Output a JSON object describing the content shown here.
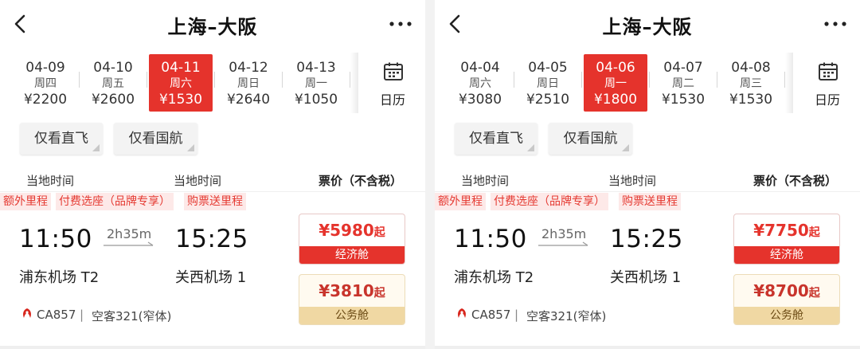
{
  "panels": [
    {
      "title": "上海–大阪",
      "dates": [
        {
          "date": "04-09",
          "week": "周四",
          "price": "¥2200"
        },
        {
          "date": "04-10",
          "week": "周五",
          "price": "¥2600"
        },
        {
          "date": "04-11",
          "week": "周六",
          "price": "¥1530"
        },
        {
          "date": "04-12",
          "week": "周日",
          "price": "¥2640"
        },
        {
          "date": "04-13",
          "week": "周一",
          "price": "¥1050"
        }
      ],
      "selected_date_index": 2,
      "calendar_label": "日历",
      "filters": [
        "仅看直飞",
        "仅看国航"
      ],
      "columns": {
        "depart": "当地时间",
        "arrive": "当地时间",
        "price": "票价（不含税）"
      },
      "tags": [
        "额外里程",
        "付费选座（品牌专享）",
        "购票送里程"
      ],
      "flight": {
        "depart_time": "11:50",
        "arrive_time": "15:25",
        "duration": "2h35m",
        "depart_airport": "浦东机场 T2",
        "arrive_airport": "关西机场 1",
        "flight_no": "CA857",
        "separator": "|",
        "aircraft": "空客321(窄体)"
      },
      "fares": [
        {
          "price": "¥5980",
          "suffix": "起",
          "cabin": "经济舱"
        },
        {
          "price": "¥3810",
          "suffix": "起",
          "cabin": "公务舱"
        }
      ]
    },
    {
      "title": "上海–大阪",
      "dates": [
        {
          "date": "04-04",
          "week": "周六",
          "price": "¥3080"
        },
        {
          "date": "04-05",
          "week": "周日",
          "price": "¥2510"
        },
        {
          "date": "04-06",
          "week": "周一",
          "price": "¥1800"
        },
        {
          "date": "04-07",
          "week": "周二",
          "price": "¥1530"
        },
        {
          "date": "04-08",
          "week": "周三",
          "price": "¥1530"
        }
      ],
      "selected_date_index": 2,
      "calendar_label": "日历",
      "filters": [
        "仅看直飞",
        "仅看国航"
      ],
      "columns": {
        "depart": "当地时间",
        "arrive": "当地时间",
        "price": "票价（不含税）"
      },
      "tags": [
        "额外里程",
        "付费选座（品牌专享）",
        "购票送里程"
      ],
      "flight": {
        "depart_time": "11:50",
        "arrive_time": "15:25",
        "duration": "2h35m",
        "depart_airport": "浦东机场 T2",
        "arrive_airport": "关西机场 1",
        "flight_no": "CA857",
        "separator": "|",
        "aircraft": "空客321(窄体)"
      },
      "fares": [
        {
          "price": "¥7750",
          "suffix": "起",
          "cabin": "经济舱"
        },
        {
          "price": "¥8700",
          "suffix": "起",
          "cabin": "公务舱"
        }
      ]
    }
  ],
  "colors": {
    "accent": "#e5332c",
    "business": "#f0d8a3",
    "tag_bg": "#fde9e8"
  },
  "icons": [
    "back-arrow-icon",
    "more-dots-icon",
    "calendar-icon",
    "air-china-logo-icon"
  ]
}
